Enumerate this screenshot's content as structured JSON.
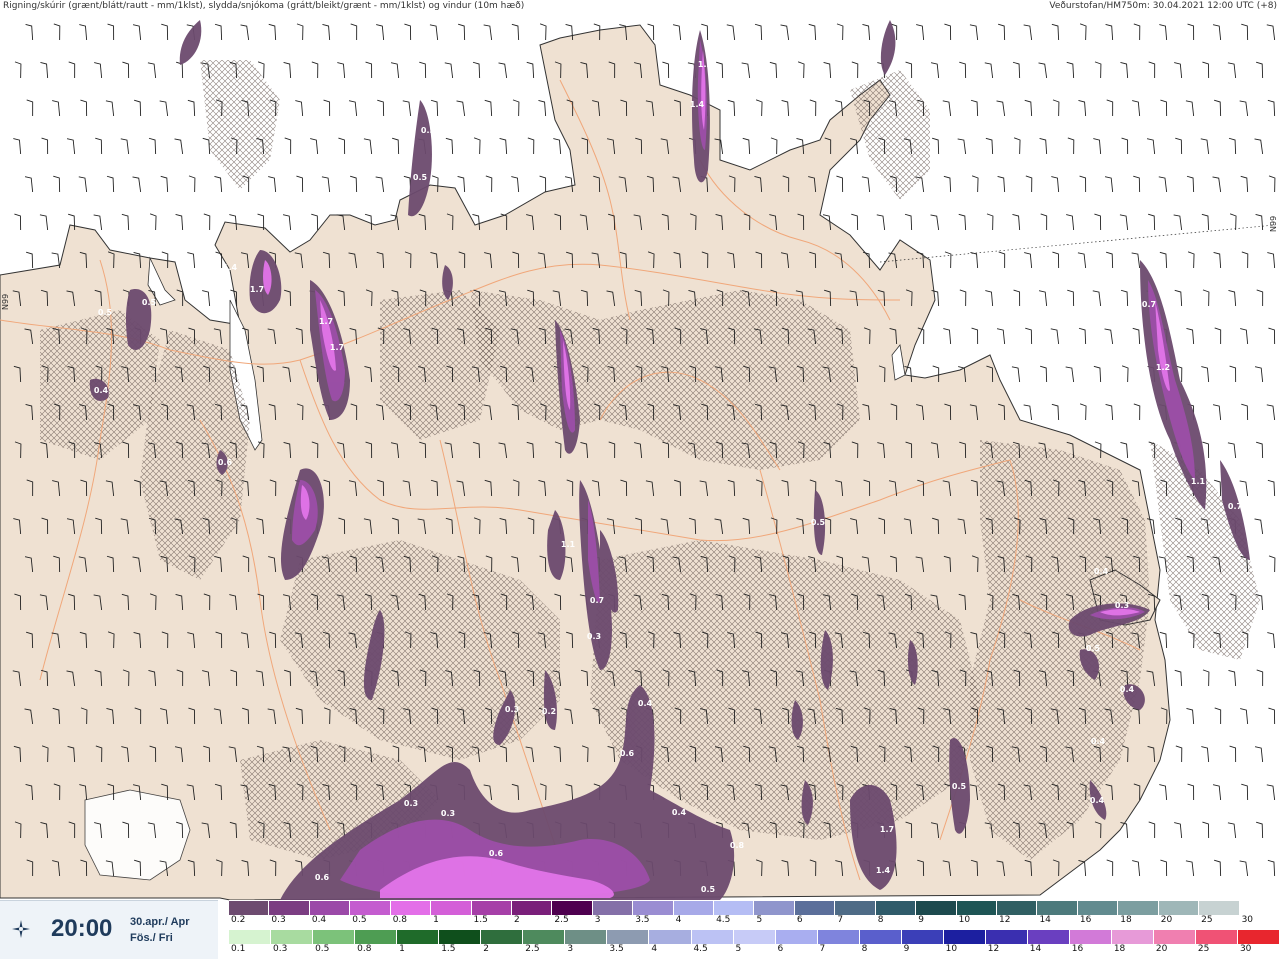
{
  "header": {
    "left": "Rigning/skúrir (grænt/blátt/rautt - mm/1klst), slydda/snjókoma (grátt/bleikt/grænt - mm/1klst) og vindur (10m hæð)",
    "right": "Veðurstofan/HM750m: 30.04.2021 12:00 UTC (+8)"
  },
  "lat_labels": [
    "N99",
    "N99"
  ],
  "time_panel": {
    "time": "20:00",
    "date_line1": "30.apr./ Apr",
    "date_line2": "Fös./ Fri",
    "logo_icon": "met-office-logo-icon"
  },
  "legend": {
    "snow_scale": {
      "labels": [
        "0.2",
        "0.3",
        "0.4",
        "0.5",
        "0.8",
        "1",
        "1.5",
        "2",
        "2.5",
        "3",
        "3.5",
        "4",
        "4.5",
        "5",
        "6",
        "7",
        "8",
        "9",
        "10",
        "12",
        "14",
        "16",
        "18",
        "20",
        "25",
        "30"
      ],
      "colors": [
        "#6d4b70",
        "#7b3d82",
        "#9b49a8",
        "#c45ccf",
        "#e36fe8",
        "#d45fd8",
        "#a63fa8",
        "#7a1f7a",
        "#4e004f",
        "#8470a8",
        "#9a8dd2",
        "#a7a9e8",
        "#b5bdf4",
        "#8f95cc",
        "#5b6f9a",
        "#4e6b86",
        "#2f5b6a",
        "#1d4a4e",
        "#1e5555",
        "#305f63",
        "#4d7a7c",
        "#628b8f",
        "#7c9ea0",
        "#9fb7b8",
        "#c7d2d2",
        "#ffffff"
      ]
    },
    "rain_scale": {
      "labels": [
        "0.1",
        "0.3",
        "0.5",
        "0.8",
        "1",
        "1.5",
        "2",
        "2.5",
        "3",
        "3.5",
        "4",
        "4.5",
        "5",
        "6",
        "7",
        "8",
        "9",
        "10",
        "12",
        "14",
        "16",
        "18",
        "20",
        "25",
        "30"
      ],
      "colors": [
        "#d6f3d0",
        "#a8dba0",
        "#7cc27a",
        "#4e9d53",
        "#1f6b2a",
        "#0f4f1c",
        "#2f6e3d",
        "#4e8a5d",
        "#6e8f86",
        "#8d9bb1",
        "#a7aee0",
        "#bcc2f4",
        "#c7cbf7",
        "#a9aef0",
        "#7f84dd",
        "#5a5fcc",
        "#3b3fb8",
        "#1c1fa0",
        "#3a2fb0",
        "#6a3fc0",
        "#d27ad8",
        "#e79ad8",
        "#f07fb0",
        "#f05275",
        "#e8262e"
      ]
    },
    "values": [
      {
        "label": "1.2"
      },
      {
        "label": "1.4"
      },
      {
        "label": "0.5"
      },
      {
        "label": "0.5"
      },
      {
        "label": "1.4"
      },
      {
        "label": "1.7"
      },
      {
        "label": "1.7"
      },
      {
        "label": "1.7"
      },
      {
        "label": "0.5"
      },
      {
        "label": "0.5"
      },
      {
        "label": "0.4"
      },
      {
        "label": "0.6"
      },
      {
        "label": "1.2"
      },
      {
        "label": "1.1"
      },
      {
        "label": "0.7"
      },
      {
        "label": "0.7"
      },
      {
        "label": "0.4"
      },
      {
        "label": "0.3"
      },
      {
        "label": "0.5"
      },
      {
        "label": "0.4"
      },
      {
        "label": "0.4"
      },
      {
        "label": "0.4"
      },
      {
        "label": "1.1"
      },
      {
        "label": "0.7"
      },
      {
        "label": "0.3"
      },
      {
        "label": "0.2"
      },
      {
        "label": "0.4"
      },
      {
        "label": "0.6"
      },
      {
        "label": "0.3"
      },
      {
        "label": "0.3"
      },
      {
        "label": "0.3"
      },
      {
        "label": "0.6"
      },
      {
        "label": "0.6"
      },
      {
        "label": "0.4"
      },
      {
        "label": "0.8"
      },
      {
        "label": "0.5"
      },
      {
        "label": "1.7"
      },
      {
        "label": "1.4"
      },
      {
        "label": "0.5"
      },
      {
        "label": "0.5"
      }
    ]
  },
  "colors": {
    "land": "#efe1d2",
    "sea": "#ffffff",
    "roads": "#f0a77a",
    "precip_dark": "#6c4a6e",
    "precip_mid": "#9c4ea8",
    "precip_light": "#e274e8"
  }
}
